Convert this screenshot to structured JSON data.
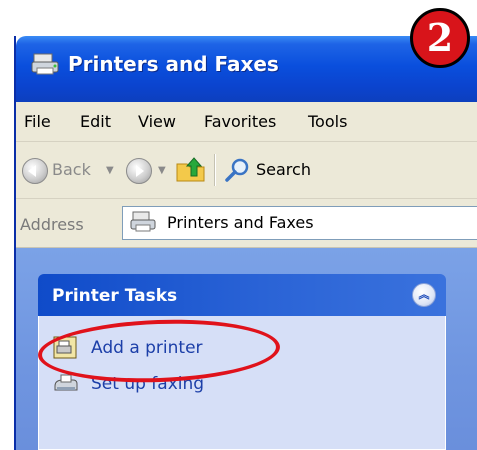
{
  "window": {
    "title": "Printers and Faxes"
  },
  "menubar": {
    "items": [
      {
        "label": "File"
      },
      {
        "label": "Edit"
      },
      {
        "label": "View"
      },
      {
        "label": "Favorites"
      },
      {
        "label": "Tools"
      }
    ]
  },
  "toolbar": {
    "back_label": "Back",
    "search_label": "Search"
  },
  "address": {
    "label": "Address",
    "value": "Printers and Faxes"
  },
  "tasks": {
    "title": "Printer Tasks",
    "items": [
      {
        "label": "Add a printer",
        "icon": "add-printer-icon"
      },
      {
        "label": "Set up faxing",
        "icon": "fax-icon"
      }
    ]
  },
  "annotation": {
    "step_number": "2",
    "badge_color": "#d8141a",
    "highlight_color": "#e0121b"
  }
}
